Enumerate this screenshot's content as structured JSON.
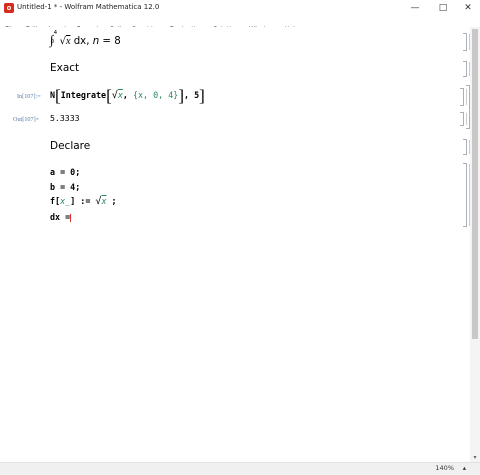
{
  "window": {
    "title": "Untitled-1 * - Wolfram Mathematica 12.0",
    "buttons": {
      "minimize": "—",
      "maximize": "□",
      "close": "✕"
    }
  },
  "menu": [
    "File",
    "Edit",
    "Insert",
    "Format",
    "Cell",
    "Graphics",
    "Evaluation",
    "Palettes",
    "Window",
    "Help"
  ],
  "cells": {
    "integral_text": {
      "lower": "0",
      "upper": "4",
      "integrand": "x",
      "tail": "dx,",
      "n_label": "n",
      "n_value": "= 8"
    },
    "exact_heading": "Exact",
    "in107_label": "In[107]:=",
    "in107": {
      "head": "N",
      "func": "Integrate",
      "var": "x",
      "range": "{x, 0, 4}",
      "digits": "5"
    },
    "out107_label": "Out[107]=",
    "out107": "5.3333",
    "declare_heading": "Declare",
    "decl_a": "a = 0;",
    "decl_b": "b = 4;",
    "decl_f": {
      "lhs": "f[",
      "arg": "x_",
      "rhs_open": "] :=",
      "var": "x",
      "end": ";"
    },
    "decl_dx": "dx ="
  },
  "status": {
    "zoom": "140%"
  }
}
